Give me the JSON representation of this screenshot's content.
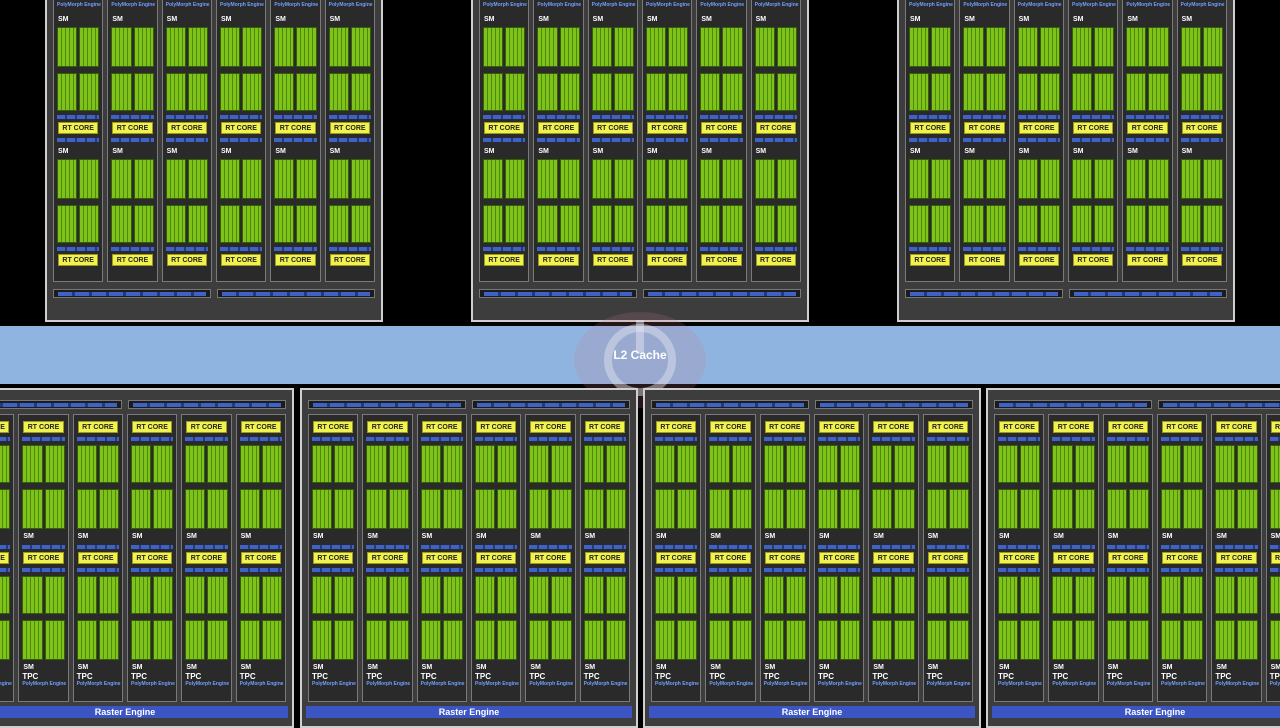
{
  "diagram": {
    "l2_cache_label": "L2 Cache",
    "tpc_label": "TPC",
    "polymorph_label": "PolyMorph Engine",
    "sm_label": "SM",
    "rt_core_label": "RT CORE",
    "raster_engine_label": "Raster Engine",
    "top_gpc_count": 3,
    "bottom_gpc_count": 4,
    "tpcs_per_gpc": 6
  },
  "colors": {
    "background": "#000000",
    "l2_cache": "#8fb4e0",
    "cuda_core": "#7ec21a",
    "rt_core": "#f2f24e",
    "raster_engine": "#3b56c4"
  },
  "icons": {
    "watermark": "power-icon"
  }
}
